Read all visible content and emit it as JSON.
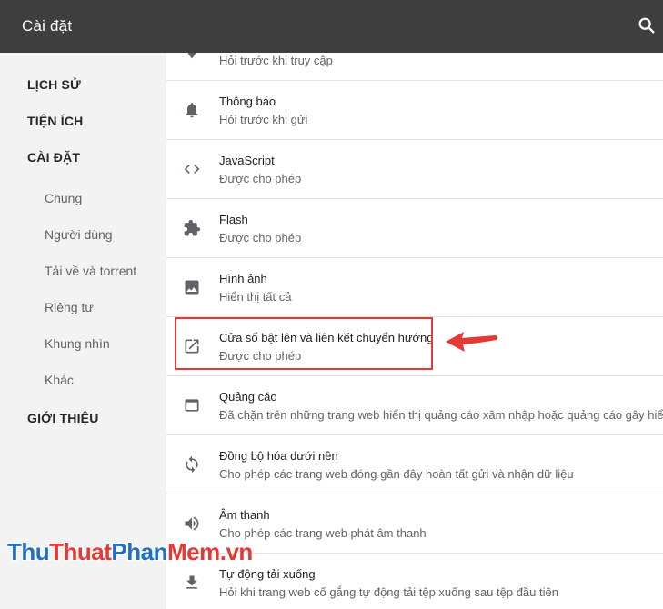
{
  "header": {
    "title": "Cài đặt",
    "search_icon": "search-icon"
  },
  "sidebar": {
    "sections": [
      {
        "label": "LỊCH SỬ"
      },
      {
        "label": "TIỆN ÍCH"
      },
      {
        "label": "CÀI ĐẶT"
      },
      {
        "label": "GIỚI THIỆU"
      }
    ],
    "subitems": [
      {
        "label": "Chung"
      },
      {
        "label": "Người dùng"
      },
      {
        "label": "Tải về và torrent"
      },
      {
        "label": "Riêng tư"
      },
      {
        "label": "Khung nhìn"
      },
      {
        "label": "Khác"
      }
    ]
  },
  "settings": {
    "rows": [
      {
        "name": "",
        "desc": "Hỏi trước khi truy cập",
        "icon": "location-icon"
      },
      {
        "name": "Thông báo",
        "desc": "Hỏi trước khi gửi",
        "icon": "bell-icon"
      },
      {
        "name": "JavaScript",
        "desc": "Được cho phép",
        "icon": "code-icon"
      },
      {
        "name": "Flash",
        "desc": "Được cho phép",
        "icon": "puzzle-icon"
      },
      {
        "name": "Hình ảnh",
        "desc": "Hiển thị tất cả",
        "icon": "image-icon"
      },
      {
        "name": "Cửa sổ bật lên và liên kết chuyển hướng",
        "desc": "Được cho phép",
        "icon": "open-in-new-icon"
      },
      {
        "name": "Quảng cáo",
        "desc": "Đã chặn trên những trang web hiển thị quảng cáo xâm nhập hoặc quảng cáo gây hiểu",
        "icon": "browser-window-icon"
      },
      {
        "name": "Đồng bộ hóa dưới nền",
        "desc": "Cho phép các trang web đóng gần đây hoàn tất gửi và nhận dữ liệu",
        "icon": "sync-icon"
      },
      {
        "name": "Âm thanh",
        "desc": "Cho phép các trang web phát âm thanh",
        "icon": "volume-icon"
      },
      {
        "name": "Tự động tải xuống",
        "desc": "Hỏi khi trang web cố gắng tự động tải tệp xuống sau tệp đầu tiên",
        "icon": "download-icon"
      }
    ]
  },
  "annotation": {
    "highlight_color": "#e53935"
  },
  "watermark": {
    "part1": "Thu",
    "part2": "Thuat",
    "part3": "Phan",
    "part4": "Mem",
    "part5": ".vn"
  },
  "colors": {
    "header_bg": "#3f3f3f",
    "sidebar_bg": "#f3f3f3",
    "icon": "#5f6368"
  }
}
